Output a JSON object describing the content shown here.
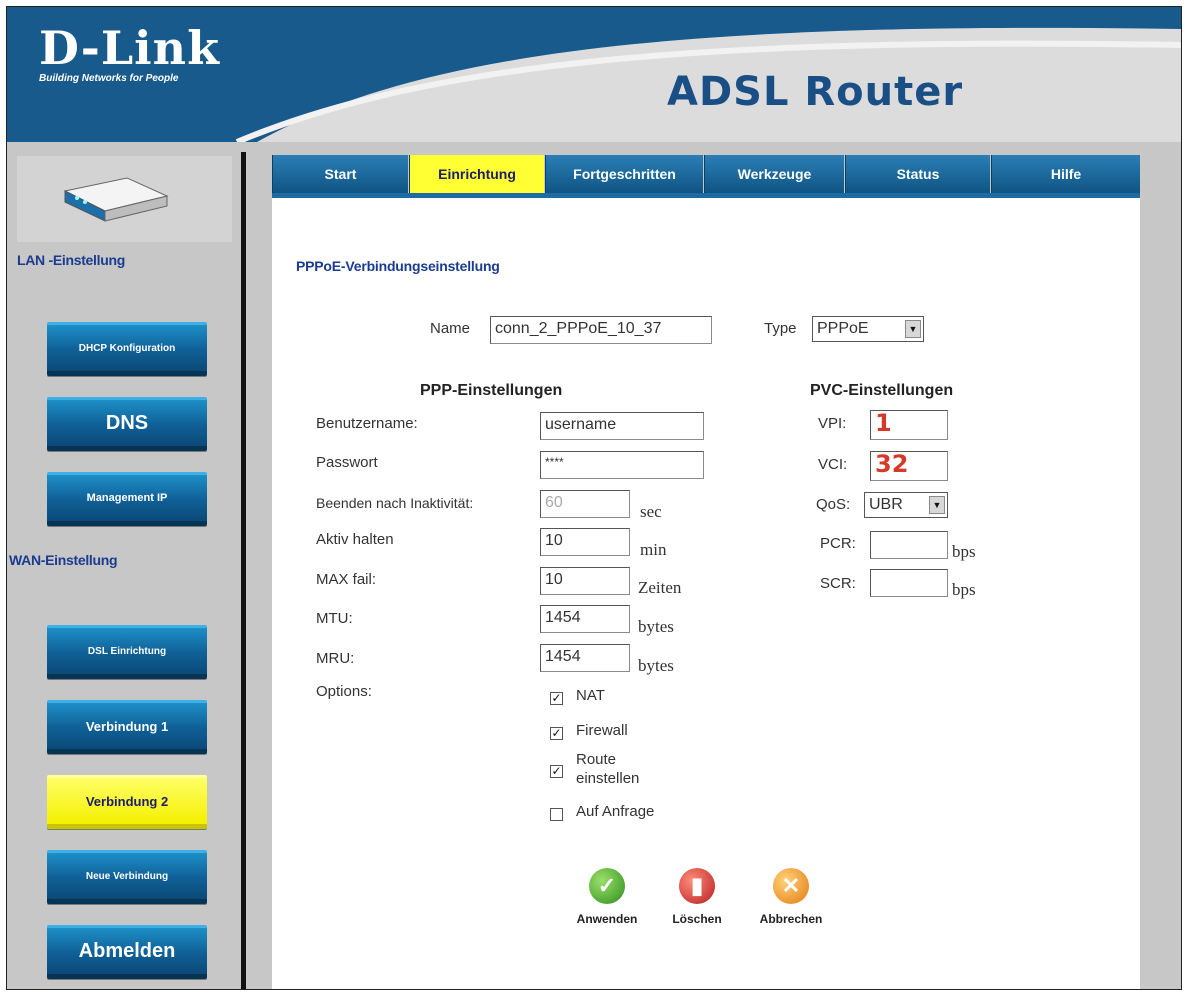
{
  "header": {
    "brand": "D-Link",
    "tagline": "Building Networks for People",
    "product": "ADSL Router"
  },
  "sidebar": {
    "lan_heading": "LAN -Einstellung",
    "wan_heading": "WAN-Einstellung",
    "lan_items": [
      {
        "label": "DHCP Konfiguration"
      },
      {
        "label": "DNS"
      },
      {
        "label": "Management IP"
      }
    ],
    "wan_items": [
      {
        "label": "DSL Einrichtung"
      },
      {
        "label": "Verbindung 1"
      },
      {
        "label": "Verbindung 2",
        "active": true
      },
      {
        "label": "Neue Verbindung"
      }
    ],
    "logout": "Abmelden"
  },
  "tabs": [
    {
      "label": "Start"
    },
    {
      "label": "Einrichtung",
      "active": true
    },
    {
      "label": "Fortgeschritten"
    },
    {
      "label": "Werkzeuge"
    },
    {
      "label": "Status"
    },
    {
      "label": "Hilfe"
    }
  ],
  "page": {
    "title": "PPPoE-Verbindungseinstellung",
    "name_label": "Name",
    "name_value": "conn_2_PPPoE_10_37",
    "type_label": "Type",
    "type_value": "PPPoE"
  },
  "ppp": {
    "heading": "PPP-Einstellungen",
    "username_label": "Benutzername:",
    "username_value": "username",
    "password_label": "Passwort",
    "password_value": "****",
    "idle_label": "Beenden nach Inaktivität:",
    "idle_value": "60",
    "idle_unit": "sec",
    "keepalive_label": "Aktiv halten",
    "keepalive_value": "10",
    "keepalive_unit": "min",
    "maxfail_label": "MAX fail:",
    "maxfail_value": "10",
    "maxfail_unit": "Zeiten",
    "mtu_label": "MTU:",
    "mtu_value": "1454",
    "mtu_unit": "bytes",
    "mru_label": "MRU:",
    "mru_value": "1454",
    "mru_unit": "bytes",
    "options_label": "Options:",
    "options": [
      {
        "label": "NAT",
        "checked": true
      },
      {
        "label": "Firewall",
        "checked": true
      },
      {
        "label": "Route einstellen",
        "line1": "Route",
        "line2": "einstellen",
        "checked": true
      },
      {
        "label": "Auf Anfrage",
        "checked": false
      }
    ]
  },
  "pvc": {
    "heading": "PVC-Einstellungen",
    "vpi_label": "VPI:",
    "vpi_value": "1",
    "vci_label": "VCI:",
    "vci_value": "32",
    "qos_label": "QoS:",
    "qos_value": "UBR",
    "pcr_label": "PCR:",
    "pcr_value": "",
    "pcr_unit": "bps",
    "scr_label": "SCR:",
    "scr_value": "",
    "scr_unit": "bps"
  },
  "actions": {
    "apply": "Anwenden",
    "delete": "Löschen",
    "cancel": "Abbrechen"
  },
  "colors": {
    "header_blue": "#185a8c",
    "nav_blue": "#0f5f96",
    "active_yellow": "#ffff33",
    "heading_blue": "#1b3b8f",
    "pvc_number_red": "#d43a2a"
  }
}
